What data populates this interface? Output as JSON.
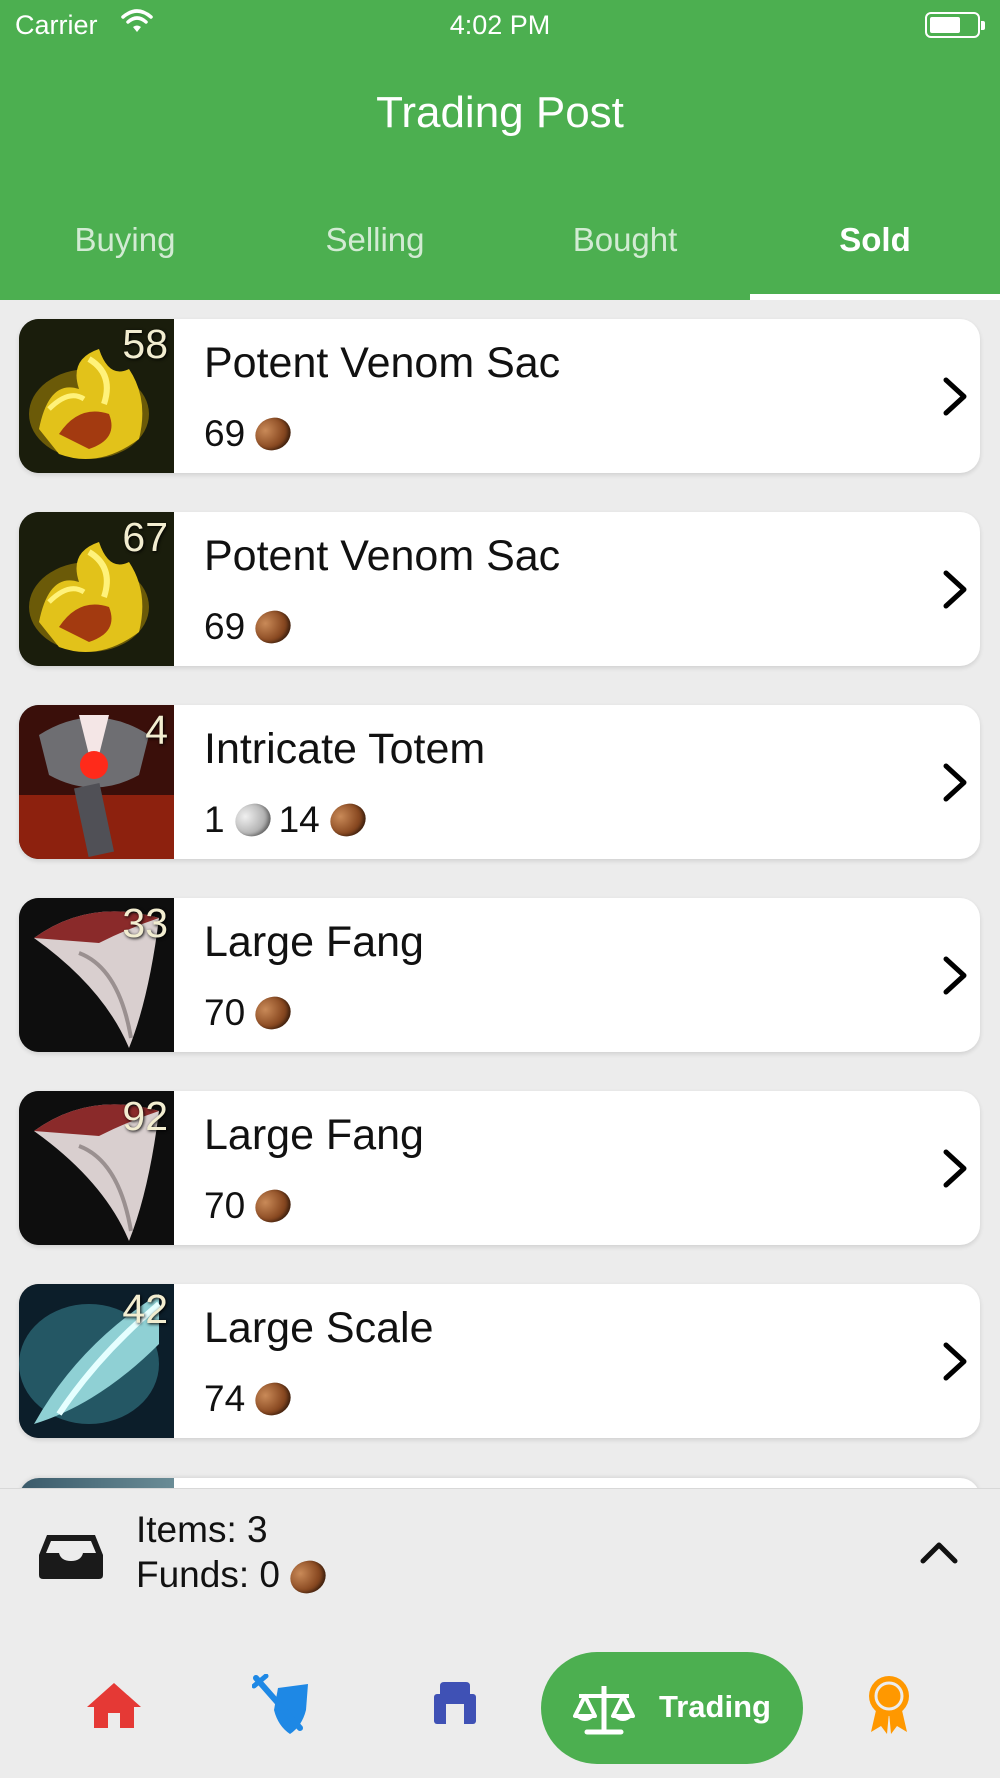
{
  "status_bar": {
    "carrier": "Carrier",
    "time": "4:02 PM"
  },
  "header": {
    "title": "Trading Post"
  },
  "tabs": [
    {
      "label": "Buying",
      "active": false
    },
    {
      "label": "Selling",
      "active": false
    },
    {
      "label": "Bought",
      "active": false
    },
    {
      "label": "Sold",
      "active": true
    }
  ],
  "items": [
    {
      "name": "Potent Venom Sac",
      "quantity": "58",
      "price": [
        {
          "amount": "69",
          "coin": "copper"
        }
      ],
      "icon": "venom-sac-icon"
    },
    {
      "name": "Potent Venom Sac",
      "quantity": "67",
      "price": [
        {
          "amount": "69",
          "coin": "copper"
        }
      ],
      "icon": "venom-sac-icon"
    },
    {
      "name": "Intricate Totem",
      "quantity": "4",
      "price": [
        {
          "amount": "1",
          "coin": "silver"
        },
        {
          "amount": "14",
          "coin": "copper"
        }
      ],
      "icon": "totem-icon"
    },
    {
      "name": "Large Fang",
      "quantity": "33",
      "price": [
        {
          "amount": "70",
          "coin": "copper"
        }
      ],
      "icon": "fang-icon"
    },
    {
      "name": "Large Fang",
      "quantity": "92",
      "price": [
        {
          "amount": "70",
          "coin": "copper"
        }
      ],
      "icon": "fang-icon"
    },
    {
      "name": "Large Scale",
      "quantity": "42",
      "price": [
        {
          "amount": "74",
          "coin": "copper"
        }
      ],
      "icon": "scale-icon"
    }
  ],
  "summary": {
    "items_label": "Items: 3",
    "funds_label": "Funds: 0",
    "funds_coin": "copper"
  },
  "bottom_nav": {
    "items": [
      {
        "icon": "home-icon",
        "active": false
      },
      {
        "icon": "pvp-shield-icon",
        "active": false
      },
      {
        "icon": "bank-icon",
        "active": false
      },
      {
        "icon": "trading-scale-icon",
        "label": "Trading",
        "active": true
      },
      {
        "icon": "achievement-icon",
        "active": false
      }
    ]
  },
  "colors": {
    "brand_green": "#4caf50",
    "home_red": "#e53935",
    "pvp_blue": "#1e88e5",
    "bank_indigo": "#3f51b5",
    "achievement_orange": "#ff9800"
  }
}
